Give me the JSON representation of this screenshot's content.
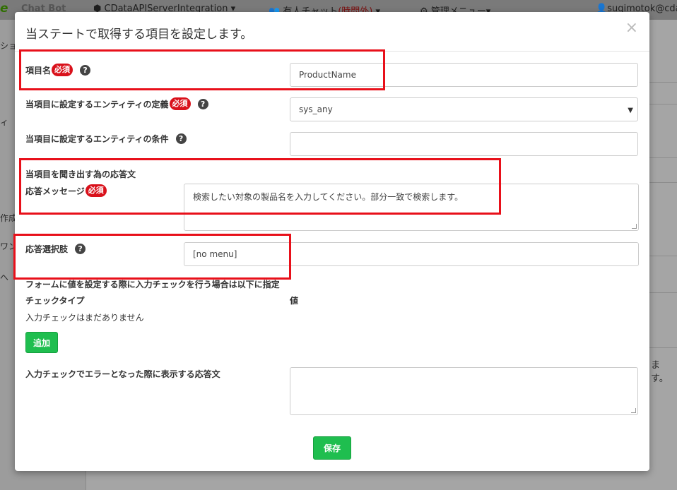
{
  "app": {
    "logo": "e",
    "brand": "Chat Bot",
    "nav_integration": "CDataAPIServerIntegration ▾",
    "nav_chat_prefix": "有人チャット",
    "nav_chat_status": "(時間外)",
    "nav_chat_caret": "▾",
    "nav_admin": "管理メニュー▾",
    "user": "sugimotok@cda",
    "left_fragments": [
      "ショ",
      "ィ",
      "作成",
      "ワン",
      "へ"
    ],
    "right_fragment": "ます。"
  },
  "modal": {
    "title": "当ステートで取得する項目を設定します。",
    "close": "×",
    "required_badge": "必須",
    "help_glyph": "?",
    "fields": {
      "item_name": {
        "label": "項目名",
        "value": "ProductName"
      },
      "entity_def": {
        "label": "当項目に設定するエンティティの定義",
        "value": "sys_any"
      },
      "entity_cond": {
        "label": "当項目に設定するエンティティの条件",
        "value": ""
      },
      "response_section": "当項目を聞き出す為の応答文",
      "response_message": {
        "label": "応答メッセージ",
        "value": "検索したい対象の製品名を入力してください。部分一致で検索します。"
      },
      "response_choices": {
        "label": "応答選択肢",
        "value": "[no menu]"
      },
      "input_check_note": "フォームに値を設定する際に入力チェックを行う場合は以下に指定",
      "check_type_header": "チェックタイプ",
      "value_header": "値",
      "empty_checks": "入力チェックはまだありません",
      "add_button": "追加",
      "error_response": {
        "label": "入力チェックでエラーとなった際に表示する応答文",
        "value": ""
      },
      "save_button": "保存"
    }
  },
  "colors": {
    "required": "#d9111b",
    "button": "#1fbe4f",
    "highlight": "#e8101a"
  }
}
